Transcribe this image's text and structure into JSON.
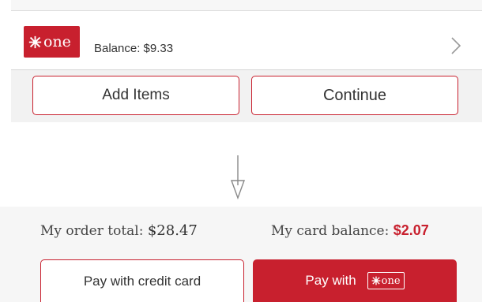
{
  "colors": {
    "brand_red": "#c8202e",
    "text_dark": "#333333",
    "panel_gray": "#f2f2f2"
  },
  "top_panel": {
    "card": {
      "logo_text": "one",
      "logo_icon": "snowflake-logo-icon",
      "balance_label": "Balance: $9.33",
      "chevron_icon": "chevron-right-icon"
    },
    "buttons": {
      "add_items": "Add Items",
      "continue": "Continue"
    }
  },
  "transition": {
    "arrow_icon": "arrow-down-icon"
  },
  "bottom_panel": {
    "order_total_label": "My order total: ",
    "order_total_value": "$28.47",
    "card_balance_label": "My card balance: ",
    "card_balance_value": "$2.07",
    "buttons": {
      "pay_credit": "Pay with credit card",
      "pay_one_prefix": "Pay with",
      "pay_one_logo_text": "one"
    }
  }
}
